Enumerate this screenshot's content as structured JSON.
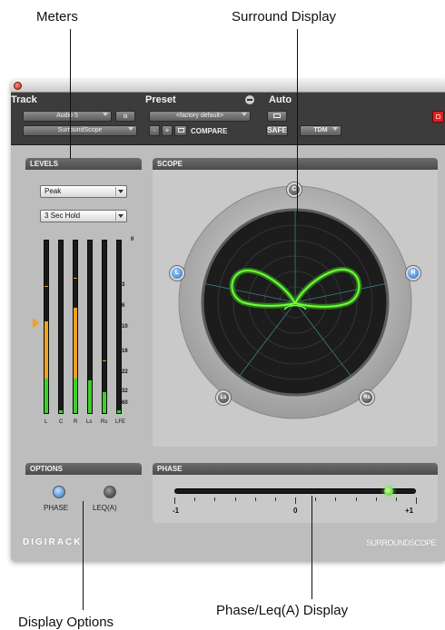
{
  "callouts": {
    "meters": "Meters",
    "surround_display": "Surround Display",
    "display_options": "Display Options",
    "phase_leq_display": "Phase/Leq(A) Display"
  },
  "header": {
    "track": {
      "title": "Track",
      "name": "Audio 5",
      "channel_selector": "a",
      "insert": "SurroundScope"
    },
    "preset": {
      "title": "Preset",
      "value": "<factory default>",
      "minus": "-",
      "plus": "+",
      "compare": "COMPARE"
    },
    "auto": {
      "title": "Auto",
      "safe": "SAFE",
      "format": "TDM"
    }
  },
  "levels": {
    "title": "LEVELS",
    "mode": "Peak",
    "hold": "3 Sec Hold",
    "scale": [
      "0",
      "-3",
      "-6",
      "-10",
      "-16",
      "-22",
      "-32",
      "-60"
    ],
    "channels": [
      "L",
      "C",
      "R",
      "Ls",
      "Rs",
      "LFE"
    ],
    "meter_levels": [
      0.53,
      0.0,
      0.61,
      0.19,
      0.12,
      0.0
    ],
    "peak_holds": [
      0.73,
      0.0,
      0.78,
      0.0,
      0.3,
      0.0
    ]
  },
  "scope": {
    "title": "SCOPE",
    "speakers": {
      "c": "C",
      "l": "L",
      "r": "R",
      "ls": "Ls",
      "rs": "Rs"
    }
  },
  "options": {
    "title": "OPTIONS",
    "phase_label": "PHASE",
    "leq_label": "LEQ(A)",
    "phase_active": true,
    "leq_active": false
  },
  "phase": {
    "title": "PHASE",
    "scale_left": "-1",
    "scale_center": "0",
    "scale_right": "+1",
    "value": 0.77
  },
  "footer": {
    "brand": "DIGIRACK",
    "product": "SURROUNDSCOPE"
  },
  "colors": {
    "accent_green": "#6dff3c",
    "meter_amber": "#f0a020",
    "speaker_blue": "#2b6fc4",
    "record_red": "#e02020"
  }
}
